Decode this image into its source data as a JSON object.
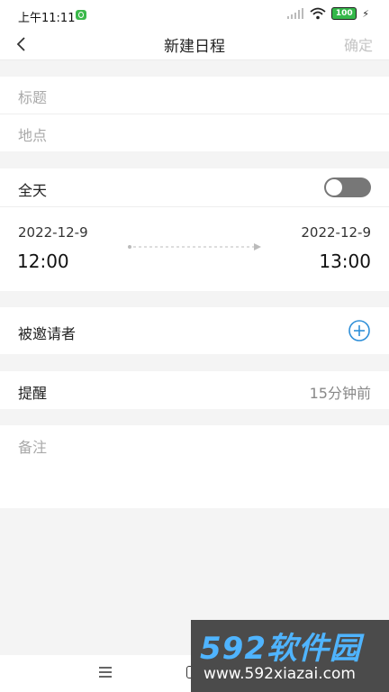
{
  "status": {
    "time": "上午11:11",
    "battery": "100"
  },
  "header": {
    "title": "新建日程",
    "confirm": "确定"
  },
  "form": {
    "title_placeholder": "标题",
    "location_placeholder": "地点",
    "all_day_label": "全天",
    "all_day_on": false,
    "start_date": "2022-12-9",
    "start_time": "12:00",
    "end_date": "2022-12-9",
    "end_time": "13:00",
    "invitees_label": "被邀请者",
    "reminder_label": "提醒",
    "reminder_value": "15分钟前",
    "notes_placeholder": "备注"
  },
  "watermark": {
    "line1": "592软件园",
    "line2": "www.592xiazai.com"
  },
  "colors": {
    "accent_blue": "#2f8fd8",
    "toggle_off": "#777777",
    "placeholder": "#a9a9a9"
  }
}
